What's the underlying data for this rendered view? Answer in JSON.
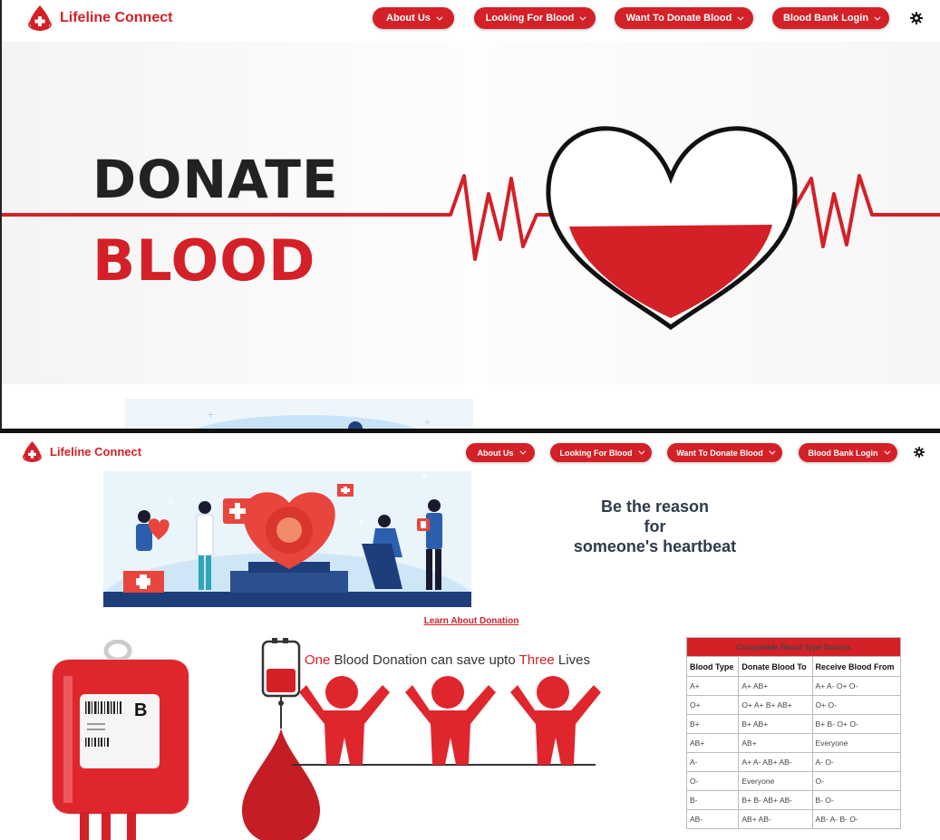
{
  "brand": {
    "name": "Lifeline Connect",
    "color": "#d42027"
  },
  "nav": {
    "items": [
      {
        "label": "About Us"
      },
      {
        "label": "Looking For Blood"
      },
      {
        "label": "Want To Donate Blood"
      },
      {
        "label": "Blood Bank Login"
      }
    ],
    "theme_icon": "gear-icon"
  },
  "hero": {
    "line1": "DONATE",
    "line2": "BLOOD"
  },
  "section": {
    "tagline_lines": [
      "Be the reason",
      "for",
      "someone's heartbeat"
    ],
    "learn_link": "Learn About Donation",
    "bag_label": "B",
    "save": {
      "one": "One",
      "middle": " Blood Donation can save upto ",
      "three": "Three",
      "end": " Lives"
    }
  },
  "compatibility": {
    "title": "Compatible Blood Type Donors",
    "headers": [
      "Blood Type",
      "Donate Blood To",
      "Receive Blood From"
    ],
    "rows": [
      [
        "A+",
        "A+ AB+",
        "A+ A- O+ O-"
      ],
      [
        "O+",
        "O+ A+ B+ AB+",
        "O+ O-"
      ],
      [
        "B+",
        "B+ AB+",
        "B+ B- O+ O-"
      ],
      [
        "AB+",
        "AB+",
        "Everyone"
      ],
      [
        "A-",
        "A+ A- AB+ AB-",
        "A- O-"
      ],
      [
        "O-",
        "Everyone",
        "O-"
      ],
      [
        "B-",
        "B+ B- AB+ AB-",
        "B- O-"
      ],
      [
        "AB-",
        "AB+ AB-",
        "AB- A- B- O-"
      ]
    ]
  }
}
